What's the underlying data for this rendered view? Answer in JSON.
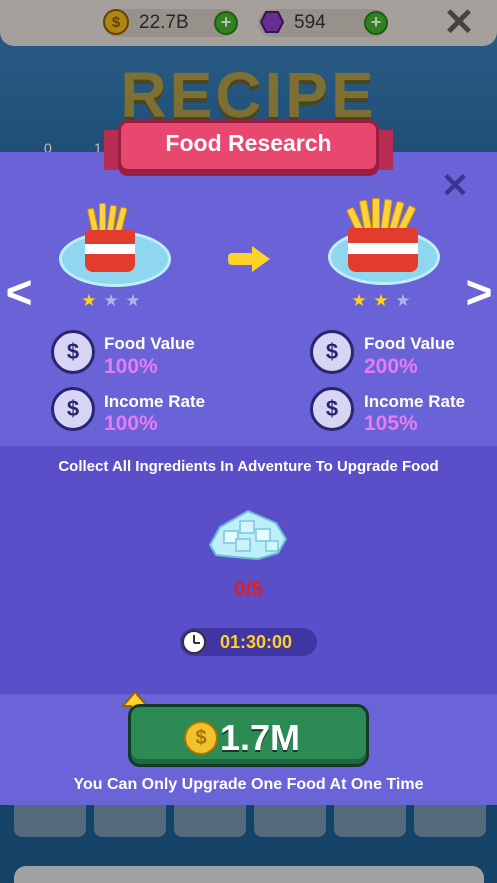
{
  "topbar": {
    "coins": "22.7B",
    "gems": "594",
    "coin_icon": "coin-icon",
    "gem_icon": "gem-icon",
    "plus_icon": "plus-icon",
    "close_icon": "close-icon"
  },
  "background": {
    "title": "RECIPE",
    "num_a": "0",
    "num_b": "1"
  },
  "modal": {
    "title": "Food Research",
    "current": {
      "stars_filled": 1,
      "stars_total": 3,
      "food_value_label": "Food Value",
      "food_value": "100%",
      "income_rate_label": "Income Rate",
      "income_rate": "100%"
    },
    "next": {
      "stars_filled": 2,
      "stars_total": 3,
      "food_value_label": "Food Value",
      "food_value": "200%",
      "income_rate_label": "Income Rate",
      "income_rate": "105%"
    },
    "instruction": "Collect All Ingredients In Adventure To Upgrade Food",
    "ingredient_icon": "ice-cubes-icon",
    "progress": "0/5",
    "timer": "01:30:00",
    "upgrade_price": "1.7M",
    "note": "You Can Only Upgrade One Food At One Time"
  },
  "colors": {
    "panel": "#5a4fc8",
    "ribbon": "#e8476e",
    "accent_value": "#e77cf2",
    "button": "#2c8a55",
    "progress": "#e51d1d",
    "timer_text": "#ffcf2d"
  }
}
